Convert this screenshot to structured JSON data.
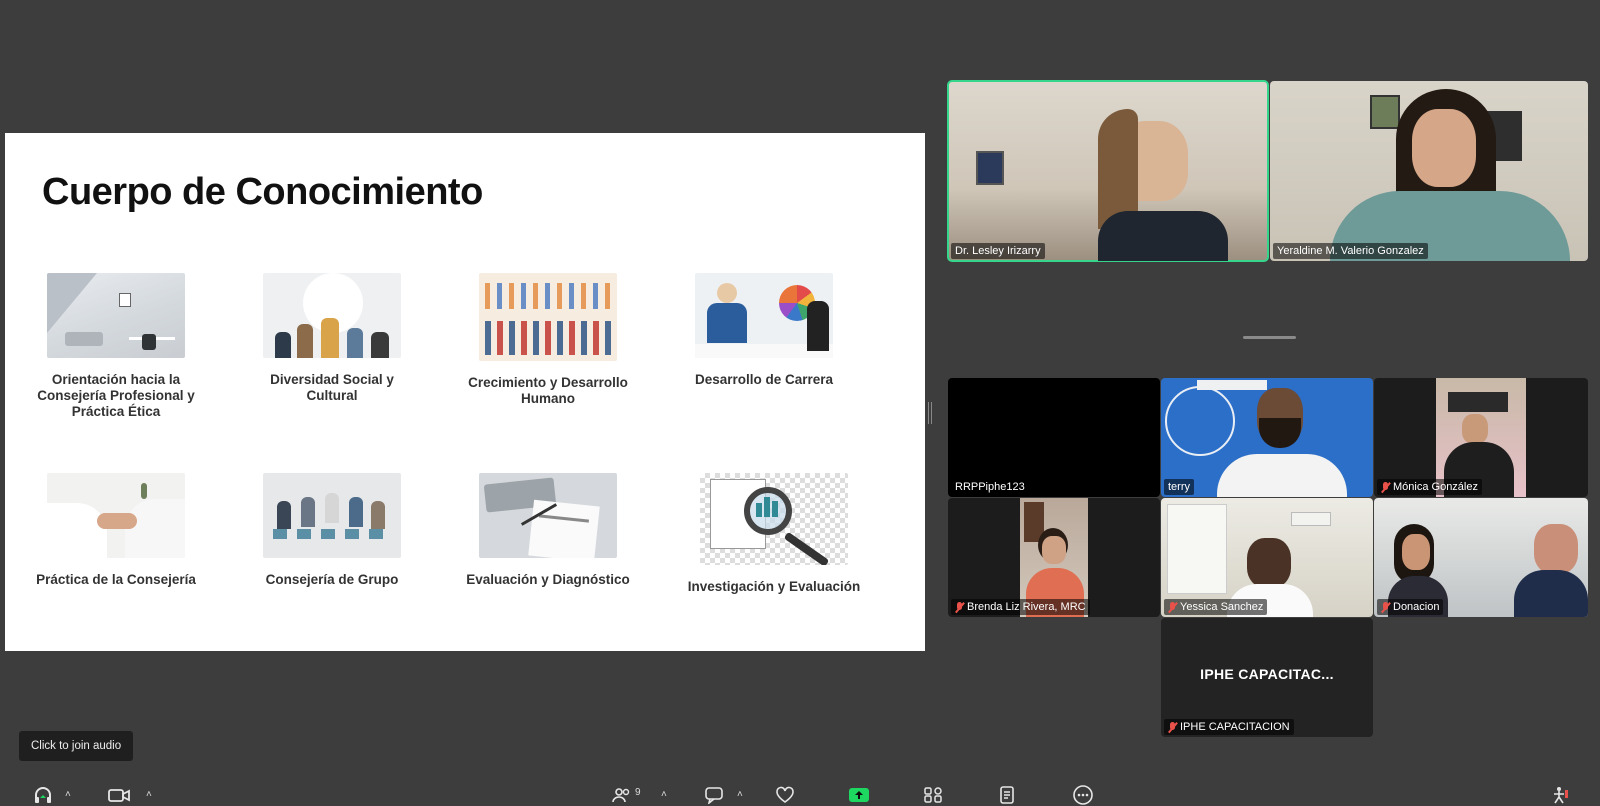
{
  "slide": {
    "title": "Cuerpo de Conocimiento",
    "topics": [
      {
        "caption": "Orientación hacia la Consejería Profesional y Práctica Ética"
      },
      {
        "caption": "Diversidad Social y Cultural"
      },
      {
        "caption": "Crecimiento y Desarrollo Humano"
      },
      {
        "caption": "Desarrollo de Carrera"
      },
      {
        "caption": "Práctica de la Consejería"
      },
      {
        "caption": "Consejería de Grupo"
      },
      {
        "caption": "Evaluación y Diagnóstico"
      },
      {
        "caption": "Investigación y Evaluación"
      }
    ]
  },
  "participants": {
    "featured": [
      {
        "name": "Dr. Lesley Irizarry"
      },
      {
        "name": "Yeraldine M. Valerio Gonzalez"
      }
    ],
    "grid": [
      {
        "name": "RRPPiphe123"
      },
      {
        "name": "terry"
      },
      {
        "name": "Mónica González"
      },
      {
        "name": "Brenda Liz Rivera, MRC"
      },
      {
        "name": "Yessica Sanchez"
      },
      {
        "name": "Donacion"
      },
      {
        "name": "IPHE CAPACITACION",
        "display_label": "IPHE CAPACITAC..."
      }
    ]
  },
  "tooltip": {
    "text": "Click to join audio"
  },
  "toolbar": {
    "participants_count": "9",
    "icons": [
      "headphones-icon",
      "video-icon",
      "participants-icon",
      "chat-icon",
      "reactions-icon",
      "share-screen-icon",
      "apps-icon",
      "notes-icon",
      "more-icon",
      "accessibility-icon"
    ]
  },
  "colors": {
    "active_speaker": "#35d68c",
    "share_green": "#1ed760",
    "background": "#3d3d3d"
  }
}
